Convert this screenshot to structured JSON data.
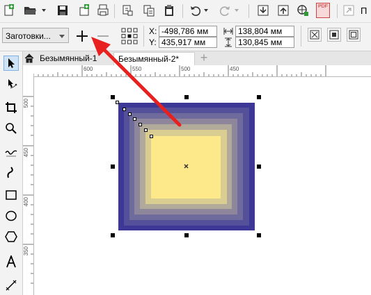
{
  "toolbar_top": {
    "icons": [
      "new-document-icon",
      "open-folder-icon",
      "save-icon",
      "import-icon",
      "print-icon",
      "cut-icon",
      "copy-icon",
      "paste-icon",
      "undo-icon",
      "redo-icon",
      "import-arrow-icon",
      "export-arrow-icon",
      "web-publish-icon",
      "pdf-icon"
    ],
    "pdf_label": "PDF",
    "cut_off_label": "П"
  },
  "property_bar": {
    "preset_value": "Заготовки...",
    "x_label": "X:",
    "y_label": "Y:",
    "x_value": "-498,786 мм",
    "y_value": "435,917 мм",
    "width_value": "138,804 мм",
    "height_value": "130,845 мм"
  },
  "tabs": [
    {
      "label": "Безымянный-1"
    },
    {
      "label": "Безымянный-2*"
    }
  ],
  "home_icon": "home-icon",
  "add_tab_label": "+",
  "ruler": {
    "h_ticks": [
      "600",
      "550",
      "500",
      "450"
    ],
    "v_ticks": [
      "500",
      "450",
      "400",
      "350"
    ]
  },
  "colors": {
    "accent_arrow": "#e8201f",
    "outer_rect": "#3d3796",
    "inner_rect": "#fde98a",
    "selected_tool": "#cfe3f7"
  }
}
